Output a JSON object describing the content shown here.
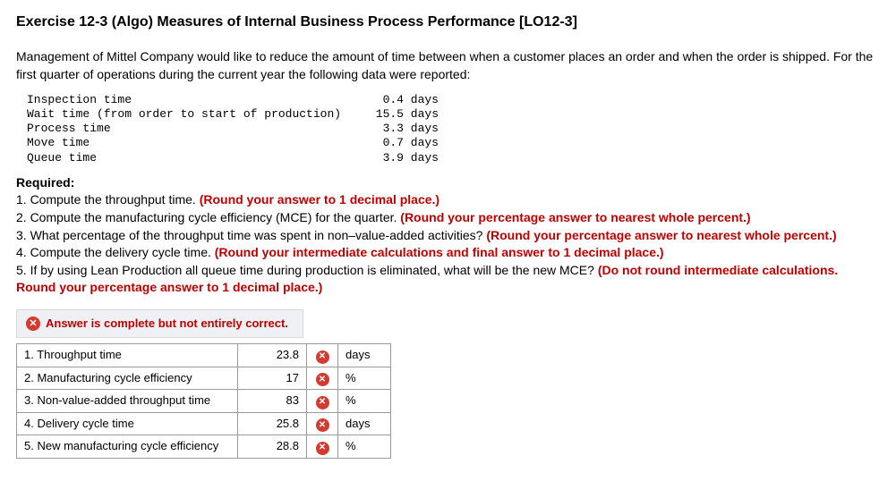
{
  "title": "Exercise 12-3 (Algo) Measures of Internal Business Process Performance [LO12-3]",
  "intro": "Management of Mittel Company would like to reduce the amount of time between when a customer places an order and when the order is shipped. For the first quarter of operations during the current year the following data were reported:",
  "data_rows": [
    {
      "label": "Inspection time",
      "value": "0.4 days"
    },
    {
      "label": "Wait time (from order to start of production)",
      "value": "15.5 days"
    },
    {
      "label": "Process time",
      "value": "3.3 days"
    },
    {
      "label": "Move time",
      "value": "0.7 days"
    },
    {
      "label": "Queue time",
      "value": "3.9 days"
    }
  ],
  "required_heading": "Required:",
  "requirements": [
    {
      "num": "1.",
      "text": "Compute the throughput time. ",
      "hint": "(Round your answer to 1 decimal place.)"
    },
    {
      "num": "2.",
      "text": "Compute the manufacturing cycle efficiency (MCE) for the quarter. ",
      "hint": "(Round your percentage answer to nearest whole percent.)"
    },
    {
      "num": "3.",
      "text": "What percentage of the throughput time was spent in non–value-added activities? ",
      "hint": "(Round your percentage answer to nearest whole percent.)"
    },
    {
      "num": "4.",
      "text": "Compute the delivery cycle time. ",
      "hint": "(Round your intermediate calculations and final answer to 1 decimal place.)"
    },
    {
      "num": "5.",
      "text": "If by using Lean Production all queue time during production is eliminated, what will be the new MCE? ",
      "hint": "(Do not round intermediate calculations. Round your percentage answer to 1 decimal place.)"
    }
  ],
  "banner": {
    "icon_glyph": "✕",
    "text": "Answer is complete but not entirely correct."
  },
  "answers": [
    {
      "label": "1. Throughput time",
      "value": "23.8",
      "mark": "wrong",
      "unit": "days"
    },
    {
      "label": "2. Manufacturing cycle efficiency",
      "value": "17",
      "mark": "wrong",
      "unit": "%"
    },
    {
      "label": "3. Non-value-added throughput time",
      "value": "83",
      "mark": "wrong",
      "unit": "%"
    },
    {
      "label": "4. Delivery cycle time",
      "value": "25.8",
      "mark": "wrong",
      "unit": "days"
    },
    {
      "label": "5. New manufacturing cycle efficiency",
      "value": "28.8",
      "mark": "wrong",
      "unit": "%"
    }
  ],
  "icon_glyph_wrong": "✕"
}
